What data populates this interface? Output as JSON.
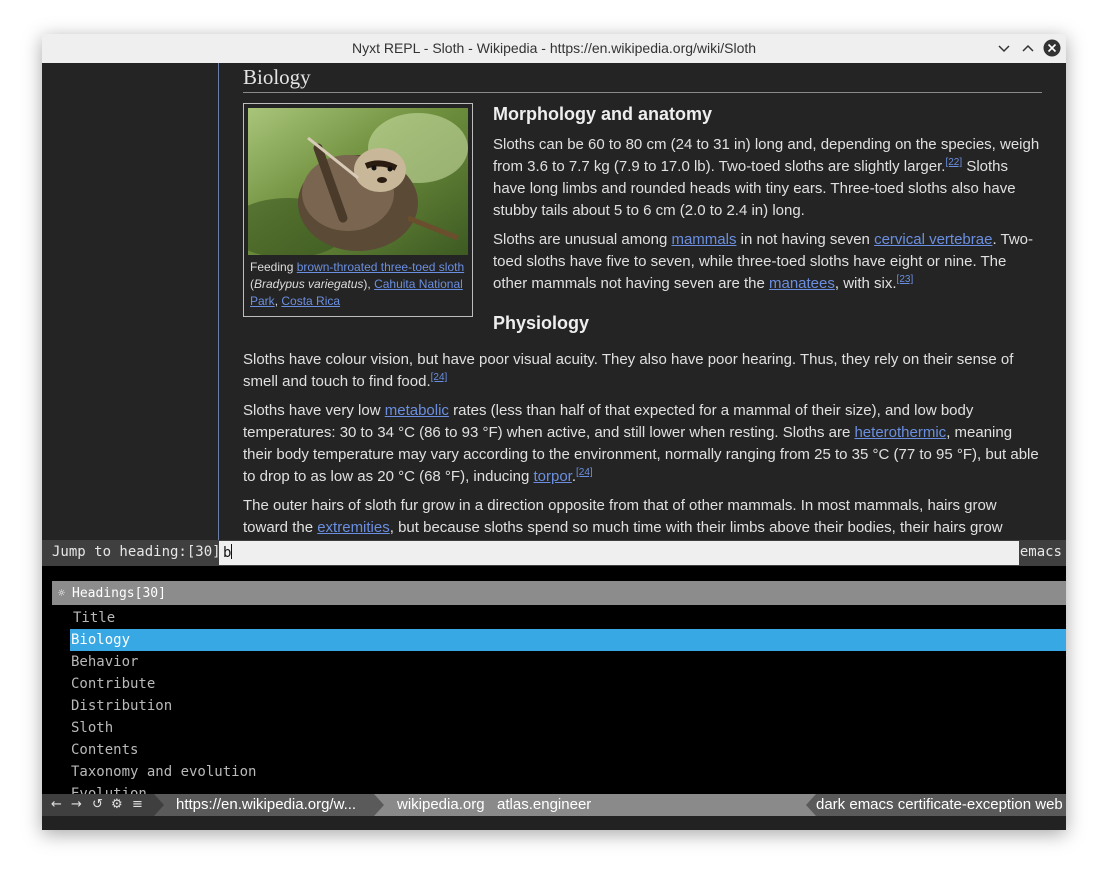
{
  "window": {
    "title": "Nyxt REPL - Sloth - Wikipedia - https://en.wikipedia.org/wiki/Sloth"
  },
  "article": {
    "section_heading": "Biology",
    "figure": {
      "caption_prefix": "Feeding ",
      "caption_link1": "brown-throated three-toed sloth",
      "caption_paren_open": " (",
      "caption_italic": "Bradypus variegatus",
      "caption_paren_close": "), ",
      "caption_link2": "Cahuita National Park",
      "caption_comma": ", ",
      "caption_link3": "Costa Rica"
    },
    "sub1": "Morphology and anatomy",
    "p1_a": "Sloths can be 60 to 80 cm (24 to 31 in) long and, depending on the species, weigh from 3.6 to 7.7 kg (7.9 to 17.0 lb). Two-toed sloths are slightly larger.",
    "p1_ref": "[22]",
    "p1_b": " Sloths have long limbs and rounded heads with tiny ears. Three-toed sloths also have stubby tails about 5 to 6 cm (2.0 to 2.4 in) long.",
    "p2_a": "Sloths are unusual among ",
    "p2_l1": "mammals",
    "p2_b": " in not having seven ",
    "p2_l2": "cervical vertebrae",
    "p2_c": ". Two-toed sloths have five to seven, while three-toed sloths have eight or nine. The other mammals not having seven are the ",
    "p2_l3": "manatees",
    "p2_d": ", with six.",
    "p2_ref": "[23]",
    "sub2": "Physiology",
    "p3_a": "Sloths have colour vision, but have poor visual acuity. They also have poor hearing. Thus, they rely on their sense of smell and touch to find food.",
    "p3_ref": "[24]",
    "p4_a": "Sloths have very low ",
    "p4_l1": "metabolic",
    "p4_b": " rates (less than half of that expected for a mammal of their size), and low body temperatures: 30 to 34 °C (86 to 93 °F) when active, and still lower when resting. Sloths are ",
    "p4_l2": "heterothermic",
    "p4_c": ", meaning their body temperature may vary according to the environment, normally ranging from 25 to 35 °C (77 to 95 °F), but able to drop to as low as 20 °C (68 °F), inducing ",
    "p4_l3": "torpor",
    "p4_d": ".",
    "p4_ref": "[24]",
    "p5_a": "The outer hairs of sloth fur grow in a direction opposite from that of other mammals. In most mammals, hairs grow toward the ",
    "p5_l1": "extremities",
    "p5_b": ", but because sloths spend so much time with their limbs above their bodies, their hairs grow"
  },
  "prompt": {
    "label": "Jump to heading:[30]",
    "input_value": "b",
    "mode": "emacs"
  },
  "suggestions": {
    "source_title": "Headings[30]",
    "items": [
      "Title",
      "Biology",
      "Behavior",
      "Contribute",
      "Distribution",
      "Sloth",
      "Contents",
      "Taxonomy and evolution",
      "Evolution"
    ],
    "selected_index": 1
  },
  "status": {
    "nav_icons": [
      "←",
      "→",
      "↺",
      "⚙",
      "≡"
    ],
    "url": "https://en.wikipedia.org/w...",
    "tabs": "wikipedia.org   atlas.engineer",
    "modes": "dark emacs certificate-exception web"
  }
}
